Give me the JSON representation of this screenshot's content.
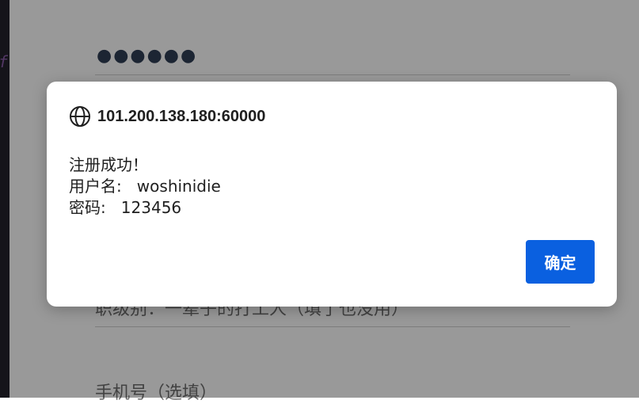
{
  "background": {
    "editor_char": "f",
    "password_dots": "●●●●●●",
    "job_field_text": "职级别：一辈子的打工人（填了也没用）",
    "phone_field_placeholder": "手机号（选填）"
  },
  "dialog": {
    "origin": "101.200.138.180:60000",
    "message_lines": [
      "注册成功！",
      "用户名:   woshinidie",
      "密码:   123456"
    ],
    "ok_label": "确定",
    "icon": "globe-icon"
  },
  "colors": {
    "overlay": "#9a9a9c",
    "ok_button": "#0a60e0",
    "editor_bg": "#23222c"
  }
}
